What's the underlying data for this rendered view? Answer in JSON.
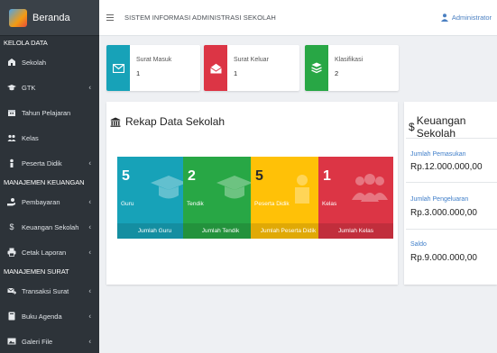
{
  "sidebar": {
    "brand": "Beranda",
    "sections": [
      "KELOLA DATA",
      "MANAJEMEN KEUANGAN",
      "MANAJEMEN SURAT"
    ],
    "items": [
      {
        "label": "Sekolah",
        "icon": "school-icon"
      },
      {
        "label": "GTK",
        "icon": "graduation-cap-icon"
      },
      {
        "label": "Tahun Pelajaran",
        "icon": "calendar-icon"
      },
      {
        "label": "Kelas",
        "icon": "users-icon"
      },
      {
        "label": "Peserta Didik",
        "icon": "student-icon"
      },
      {
        "label": "Pembayaran",
        "icon": "hand-holding-dollar-icon"
      },
      {
        "label": "Keuangan Sekolah",
        "icon": "dollar-icon"
      },
      {
        "label": "Cetak Laporan",
        "icon": "print-icon"
      },
      {
        "label": "Transaksi Surat",
        "icon": "mail-transaction-icon"
      },
      {
        "label": "Buku Agenda",
        "icon": "book-icon"
      },
      {
        "label": "Galeri File",
        "icon": "gallery-icon"
      }
    ]
  },
  "header": {
    "title": "SISTEM INFORMASI ADMINISTRASI SEKOLAH",
    "user": "Administrator"
  },
  "mail_cards": [
    {
      "label": "Surat Masuk",
      "value": "1",
      "color": "#17a2b8"
    },
    {
      "label": "Surat Keluar",
      "value": "1",
      "color": "#dc3545"
    },
    {
      "label": "Klasifikasi",
      "value": "2",
      "color": "#28a745"
    }
  ],
  "rekap": {
    "title": "Rekap Data Sekolah",
    "stats": [
      {
        "value": "5",
        "label": "Guru",
        "footer": "Jumlah Guru",
        "color": "#17a2b8"
      },
      {
        "value": "2",
        "label": "Tendik",
        "footer": "Jumlah Tendik",
        "color": "#28a745"
      },
      {
        "value": "5",
        "label": "Peserta Didik",
        "footer": "Jumlah Peserta Didik",
        "color": "#ffc107"
      },
      {
        "value": "1",
        "label": "Kelas",
        "footer": "Jumlah Kelas",
        "color": "#dc3545"
      }
    ]
  },
  "keuangan": {
    "title": "Keuangan Sekolah",
    "rows": [
      {
        "label": "Jumlah Pemasukan",
        "value": "Rp.12.000.000,00"
      },
      {
        "label": "Jumlah Pengeluaran",
        "value": "Rp.3.000.000,00"
      },
      {
        "label": "Saldo",
        "value": "Rp.9.000.000,00"
      }
    ]
  }
}
